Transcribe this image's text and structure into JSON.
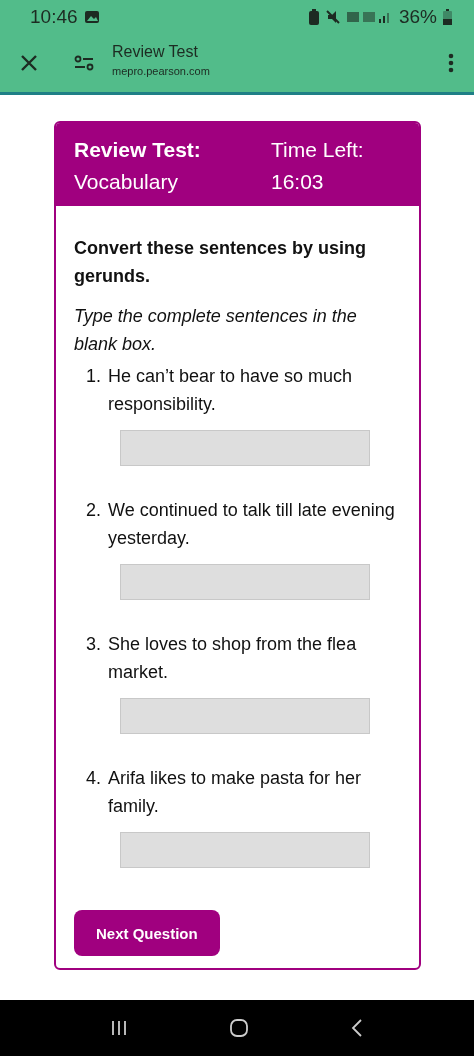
{
  "status_bar": {
    "time": "10:46",
    "battery": "36%"
  },
  "toolbar": {
    "title": "Review Test",
    "url": "mepro.pearson.com"
  },
  "card": {
    "title": "Review Test:",
    "subtitle": "Vocabulary",
    "timer_label": "Time Left:",
    "timer": "16:03",
    "instruction": "Convert these sentences by using gerunds.",
    "hint": "Type the complete sentences in the blank box.",
    "questions": [
      {
        "number": "1.",
        "text": "He can’t bear to have so much responsibility."
      },
      {
        "number": "2.",
        "text": "We continued to talk till late evening yesterday."
      },
      {
        "number": "3.",
        "text": "She loves to shop from the flea market."
      },
      {
        "number": "4.",
        "text": "Arifa likes to make pasta for her family."
      }
    ],
    "button": "Next Question"
  }
}
